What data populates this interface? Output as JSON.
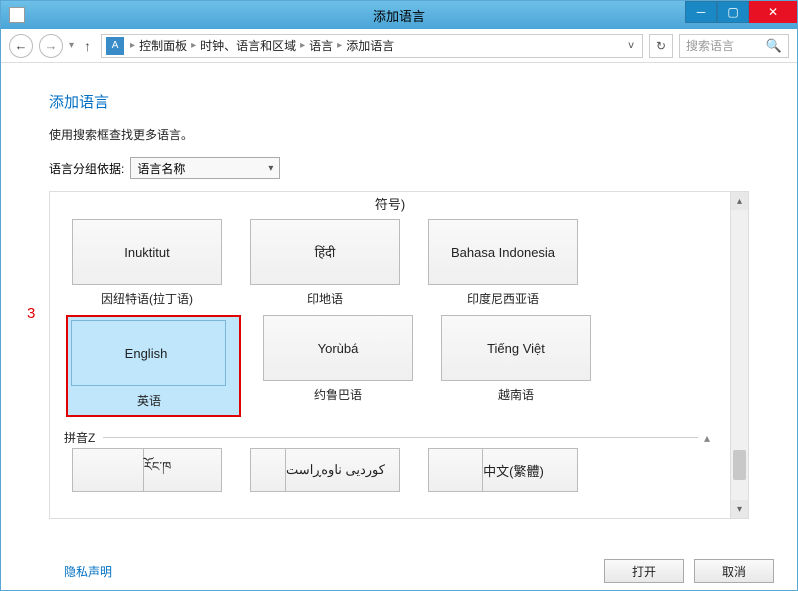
{
  "window": {
    "title": "添加语言"
  },
  "breadcrumb": {
    "items": [
      "控制面板",
      "时钟、语言和区域",
      "语言",
      "添加语言"
    ]
  },
  "search": {
    "placeholder": "搜索语言"
  },
  "page": {
    "title": "添加语言",
    "hint": "使用搜索框查找更多语言。",
    "group_label": "语言分组依据:",
    "group_value": "语言名称"
  },
  "truncated_label": "符号)",
  "rows": [
    [
      {
        "native": "Inuktitut",
        "label": "因纽特语(拉丁语)"
      },
      {
        "native": "हिंदी",
        "label": "印地语"
      },
      {
        "native": "Bahasa Indonesia",
        "label": "印度尼西亚语"
      }
    ],
    [
      {
        "native": "English",
        "label": "英语",
        "selected": true
      },
      {
        "native": "Yorùbá",
        "label": "约鲁巴语"
      },
      {
        "native": "Tiếng Việt",
        "label": "越南语"
      }
    ]
  ],
  "section_z": "拼音Z",
  "partial_row": [
    {
      "native": "རོང་ཁ"
    },
    {
      "native": "کوردیی ناوەڕاست"
    },
    {
      "native": "中文(繁體)"
    }
  ],
  "footer": {
    "privacy": "隐私声明",
    "open": "打开",
    "cancel": "取消"
  },
  "annotation": "3"
}
